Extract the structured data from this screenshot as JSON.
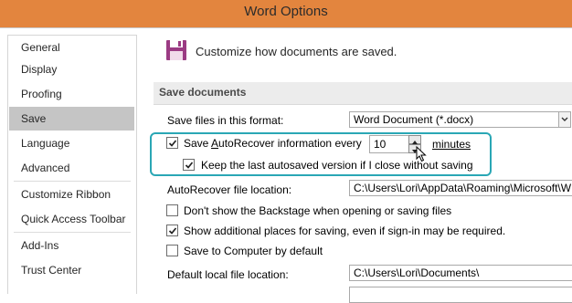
{
  "window": {
    "title": "Word Options"
  },
  "sidebar": {
    "items": [
      {
        "label": "General"
      },
      {
        "label": "Display"
      },
      {
        "label": "Proofing"
      },
      {
        "label": "Save"
      },
      {
        "label": "Language"
      },
      {
        "label": "Advanced"
      },
      {
        "label": "Customize Ribbon"
      },
      {
        "label": "Quick Access Toolbar"
      },
      {
        "label": "Add-Ins"
      },
      {
        "label": "Trust Center"
      }
    ],
    "selected": "Save"
  },
  "main": {
    "header": "Customize how documents are saved.",
    "header_icon": "save-icon",
    "section_title": "Save documents",
    "format_label": "Save files in this format:",
    "format_value": "Word Document (*.docx)",
    "autorecover_label_pre": "Save ",
    "autorecover_label_key": "A",
    "autorecover_label_post": "utoRecover information every",
    "autorecover_checked": true,
    "autorecover_minutes": "10",
    "minutes_label": "minutes",
    "keep_last_label": "Keep the last autosaved version if I close without saving",
    "keep_last_checked": true,
    "autorecover_loc_label": "AutoRecover file location:",
    "autorecover_loc_value": "C:\\Users\\Lori\\AppData\\Roaming\\Microsoft\\W",
    "dont_show_backstage_label": "Don't show the Backstage when opening or saving files",
    "dont_show_backstage_checked": false,
    "show_additional_places_label": "Show additional places for saving, even if sign-in may be required.",
    "show_additional_places_checked": true,
    "save_to_computer_label": "Save to Computer by default",
    "save_to_computer_checked": false,
    "default_local_label": "Default local file location:",
    "default_local_value": "C:\\Users\\Lori\\Documents\\"
  },
  "colors": {
    "titlebar": "#e3853e",
    "highlight": "#2aa7b5",
    "selected_nav": "#c5c5c5",
    "save_icon": "#9b3b83"
  }
}
